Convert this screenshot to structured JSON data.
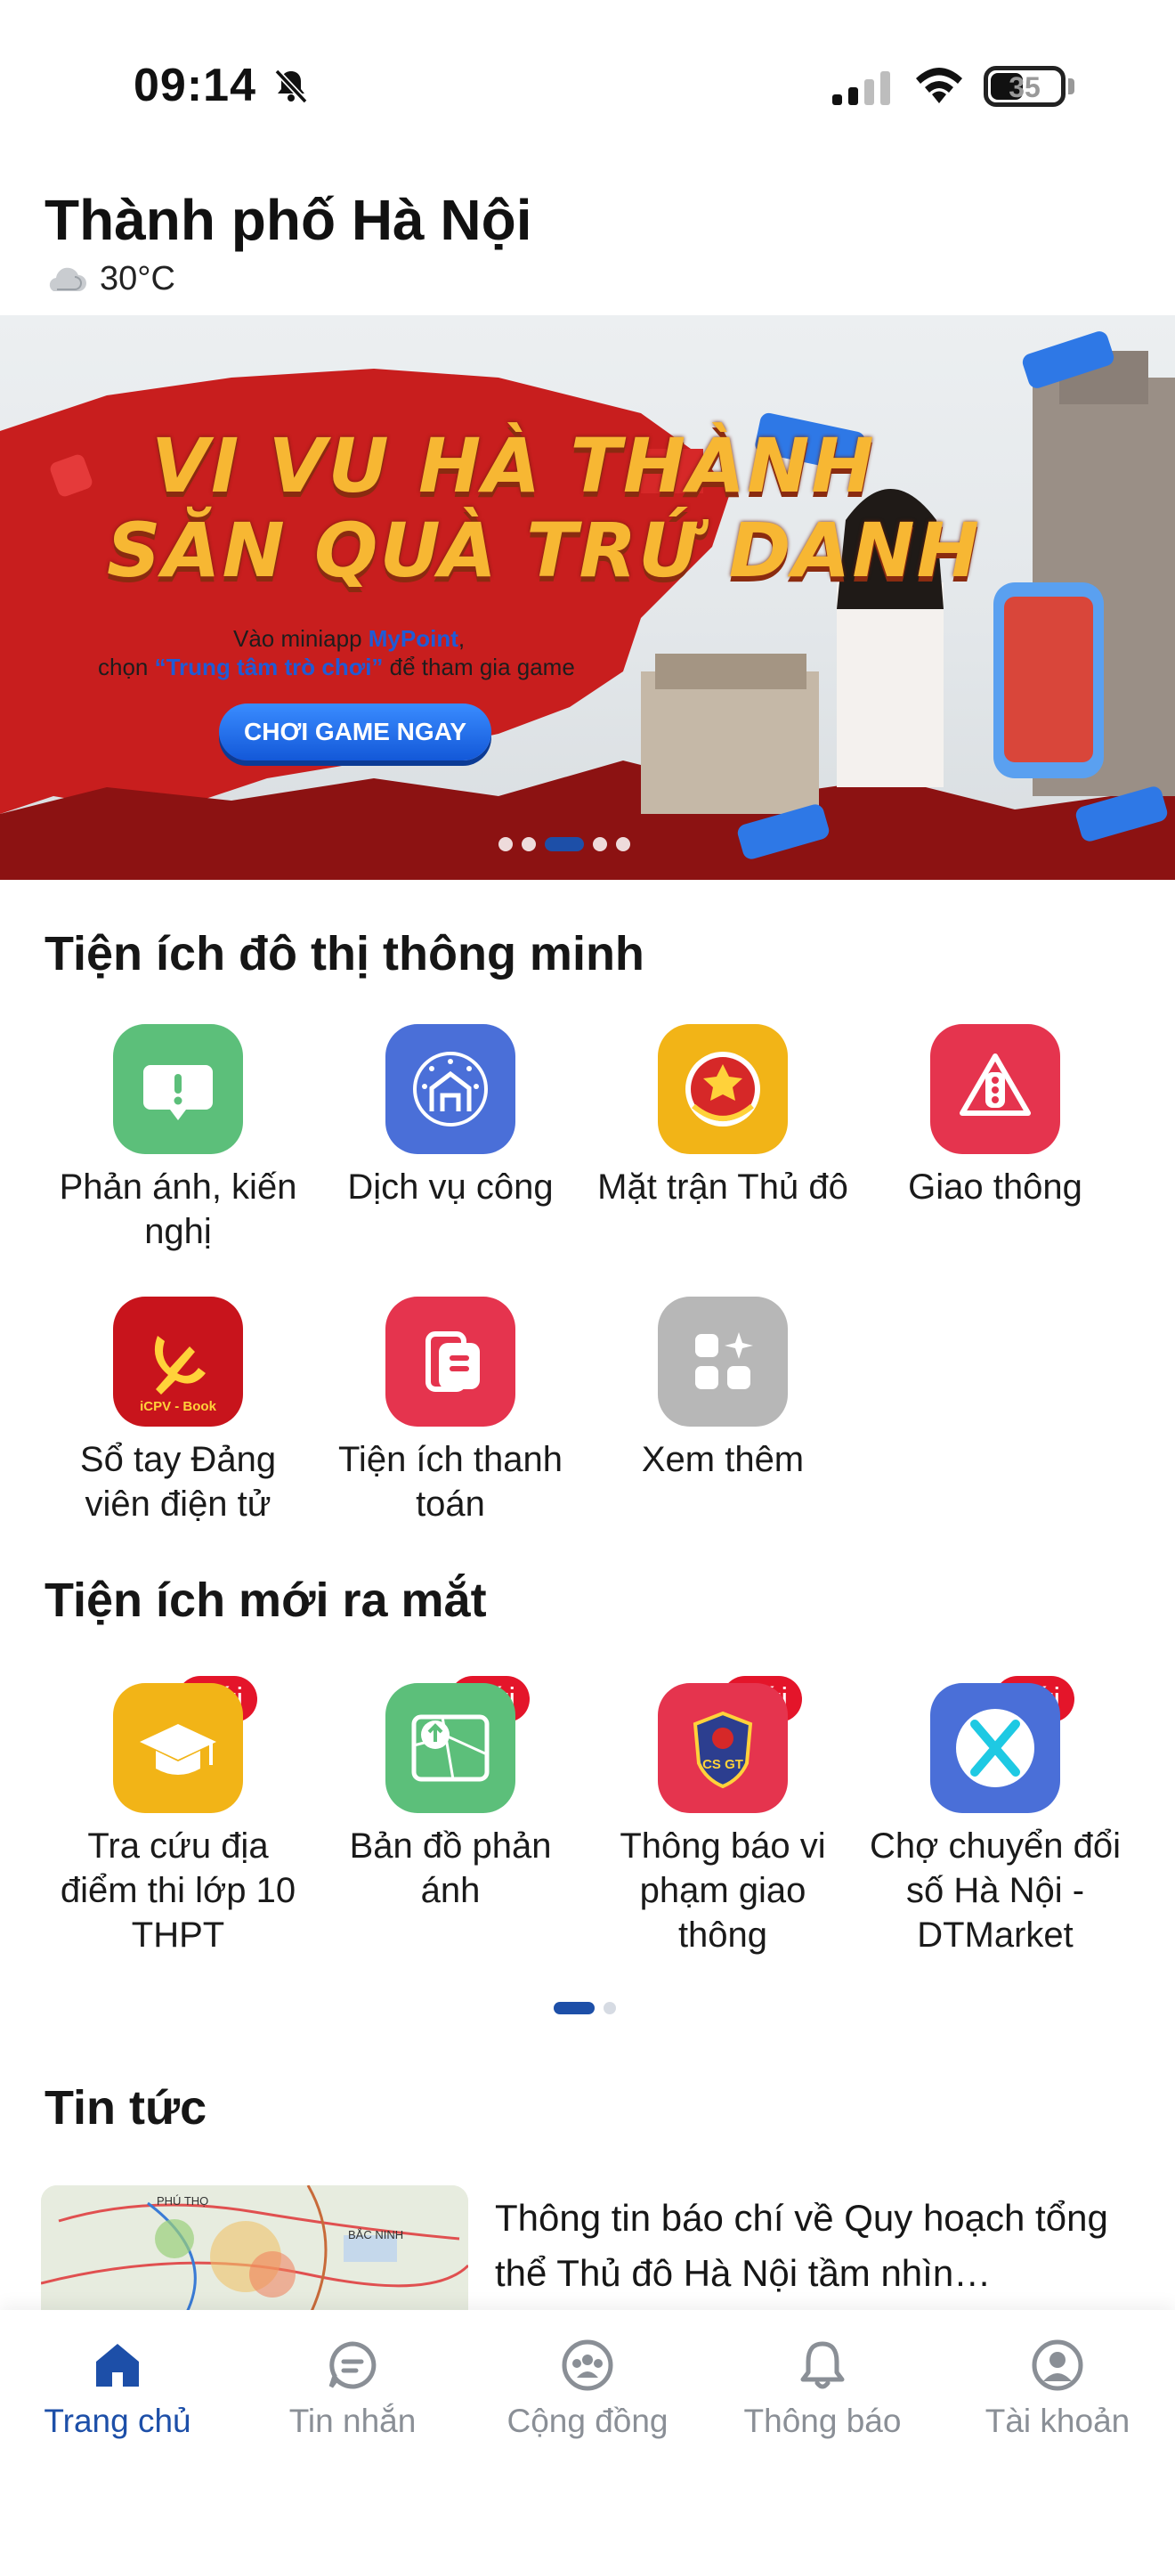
{
  "status_bar": {
    "time": "09:14",
    "battery": "35"
  },
  "header": {
    "city": "Thành phố Hà Nội",
    "temperature": "30°C",
    "weather_icon": "cloud-icon"
  },
  "banner": {
    "title_line1": "VI VU HÀ THÀNH",
    "title_line2": "SĂN QUÀ TRỨ DANH",
    "subtitle_line1_prefix": "Vào miniapp ",
    "subtitle_line1_brand": "MyPoint",
    "subtitle_line1_suffix": ",",
    "subtitle_line2_prefix": "chọn ",
    "subtitle_line2_highlight": "“Trung tâm trò chơi”",
    "subtitle_line2_suffix": " để tham gia game",
    "cta": "CHƠI GAME NGAY",
    "slide_count": 5,
    "active_slide": 3
  },
  "smart_utilities": {
    "title": "Tiện ích đô thị thông minh",
    "items": [
      {
        "label": "Phản ánh, kiến nghị",
        "icon": "feedback-icon",
        "color": "#5cbf7a"
      },
      {
        "label": "Dịch vụ công",
        "icon": "public-service-icon",
        "color": "#4a6fd8"
      },
      {
        "label": "Mặt trận Thủ đô",
        "icon": "front-emblem-icon",
        "color": "#f2b417"
      },
      {
        "label": "Giao thông",
        "icon": "traffic-light-icon",
        "color": "#e5344e"
      },
      {
        "label": "Sổ tay Đảng viên điện tử",
        "icon": "party-handbook-icon",
        "color": "#c8141c",
        "badge_text": "iCPV - Book"
      },
      {
        "label": "Tiện ích thanh toán",
        "icon": "payment-icon",
        "color": "#e5344e"
      },
      {
        "label": "Xem thêm",
        "icon": "more-apps-icon",
        "color": "#b7b7b7"
      }
    ]
  },
  "new_utilities": {
    "title": "Tiện ích mới ra mắt",
    "badge": "Mới",
    "items": [
      {
        "label": "Tra cứu địa điểm thi lớp 10 THPT",
        "icon": "graduation-cap-icon",
        "color": "#f2b417"
      },
      {
        "label": "Bản đồ phản ánh",
        "icon": "feedback-map-icon",
        "color": "#5cbf7a"
      },
      {
        "label": "Thông báo vi phạm giao thông",
        "icon": "traffic-police-icon",
        "color": "#e5344e",
        "badge_text": "CS GT"
      },
      {
        "label": "Chợ chuyển đổi số Hà Nội - DTMarket",
        "icon": "dtmarket-icon",
        "color": "#4a6fd8"
      }
    ],
    "page_count": 2,
    "active_page": 1
  },
  "news": {
    "title": "Tin tức",
    "items": [
      {
        "title": "Thông tin báo chí về Quy hoạch tổng thể Thủ đô Hà Nội tầm nhìn…",
        "thumb_labels": [
          "PHÚ THỌ",
          "BẮC NINH"
        ]
      }
    ]
  },
  "bottom_nav": [
    {
      "label": "Trang chủ",
      "icon": "home-icon",
      "active": true
    },
    {
      "label": "Tin nhắn",
      "icon": "chat-icon",
      "active": false
    },
    {
      "label": "Cộng đồng",
      "icon": "community-icon",
      "active": false
    },
    {
      "label": "Thông báo",
      "icon": "bell-icon",
      "active": false
    },
    {
      "label": "Tài khoản",
      "icon": "account-icon",
      "active": false
    }
  ],
  "colors": {
    "primary": "#1d4fa8",
    "badge_red": "#e4152a",
    "nav_inactive": "#8a8f96"
  }
}
